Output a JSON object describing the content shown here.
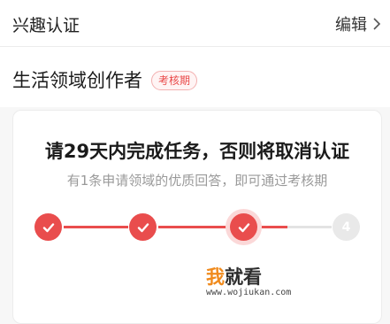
{
  "header": {
    "title": "兴趣认证",
    "edit_label": "编辑"
  },
  "role": {
    "title": "生活领域创作者",
    "badge": "考核期"
  },
  "task": {
    "title": "请29天内完成任务，否则将取消认证",
    "subtitle": "有1条申请领域的优质回答，即可通过考核期"
  },
  "steps": [
    {
      "state": "done",
      "icon": "check-icon"
    },
    {
      "state": "done",
      "icon": "check-icon"
    },
    {
      "state": "current",
      "icon": "check-icon"
    },
    {
      "state": "todo",
      "label": "4"
    }
  ],
  "watermark": {
    "logo_a": "我",
    "logo_b": "就看",
    "url": "www.wojiukan.com"
  },
  "colors": {
    "accent": "#e94d4d",
    "inactive": "#e9e9e9",
    "watermark_orange": "#f08a1c"
  }
}
